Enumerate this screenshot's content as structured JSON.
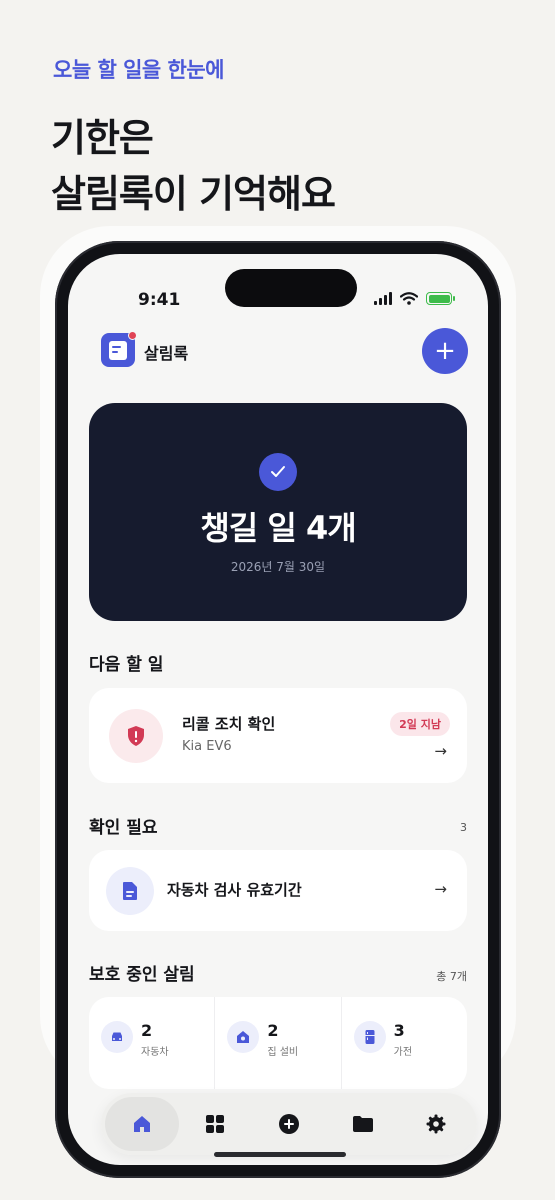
{
  "promo": {
    "eyebrow": "오늘 할 일을 한눈에",
    "headline_line1": "기한은",
    "headline_line2": "살림록이 기억해요"
  },
  "status_bar": {
    "time": "9:41",
    "icons": [
      "signal-icon",
      "wifi-icon",
      "battery-charging-icon"
    ]
  },
  "app": {
    "name": "살림록",
    "add_button_label": "+",
    "accent_color": "#4a58d8"
  },
  "hero": {
    "title": "챙길 일 4개",
    "date": "2026년 7월 30일",
    "icon": "check-icon"
  },
  "next_task": {
    "section_title": "다음 할 일",
    "title": "리콜 조치 확인",
    "subtitle": "Kia EV6",
    "badge": "2일 지남",
    "arrow": "→",
    "icon": "shield-alert-icon"
  },
  "needs_check": {
    "section_title": "확인 필요",
    "count": "3",
    "items": [
      {
        "title": "자동차 검사 유효기간",
        "arrow": "→",
        "icon": "document-icon"
      }
    ]
  },
  "protected": {
    "section_title": "보호 중인 살림",
    "total": "총 7개",
    "stats": [
      {
        "count": "2",
        "label": "자동차",
        "icon": "car-icon"
      },
      {
        "count": "2",
        "label": "집 설비",
        "icon": "house-icon"
      },
      {
        "count": "3",
        "label": "가전",
        "icon": "fridge-icon"
      }
    ]
  },
  "tabbar": {
    "tabs": [
      {
        "name": "home",
        "icon": "home-icon",
        "active": true
      },
      {
        "name": "grid",
        "icon": "grid-icon",
        "active": false
      },
      {
        "name": "add",
        "icon": "plus-circle-icon",
        "active": false
      },
      {
        "name": "folder",
        "icon": "folder-icon",
        "active": false
      },
      {
        "name": "settings",
        "icon": "gear-icon",
        "active": false
      }
    ]
  }
}
